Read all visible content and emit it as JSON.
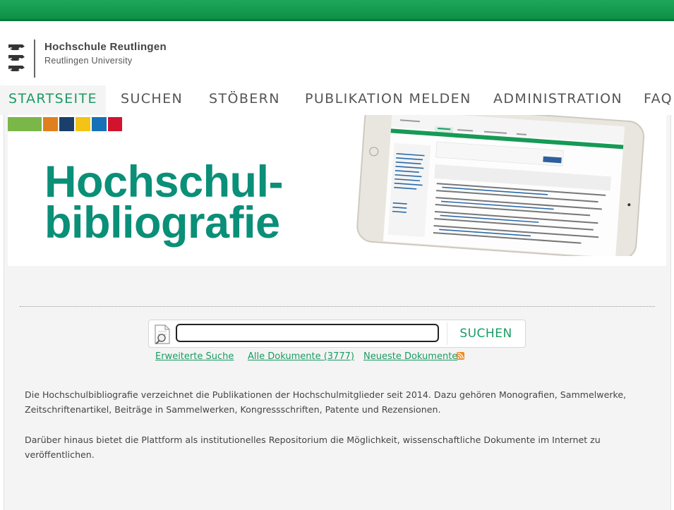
{
  "header": {
    "name": "Hochschule Reutlingen",
    "subname": "Reutlingen University"
  },
  "nav": {
    "items": [
      {
        "label": "STARTSEITE"
      },
      {
        "label": "SUCHEN"
      },
      {
        "label": "STÖBERN"
      },
      {
        "label": "PUBLIKATION MELDEN"
      },
      {
        "label": "ADMINISTRATION"
      },
      {
        "label": "FAQ"
      }
    ]
  },
  "banner": {
    "title_line1": "Hochschul-",
    "title_line2": "bibliografie",
    "color_blocks": [
      "#7ab648",
      "#e07f1d",
      "#1b3f6a",
      "#f3c316",
      "#1572b9",
      "#d1132e"
    ],
    "title_color": "#0a8f78"
  },
  "search": {
    "value": "",
    "button_label": "SUCHEN"
  },
  "links": {
    "advanced": "Erweiterte Suche",
    "all_docs": "Alle Dokumente (3777)",
    "newest": "Neueste Dokumente"
  },
  "content": {
    "paragraph1": "Die Hochschulbibliografie verzeichnet die Publikationen der Hochschulmitglieder seit 2014. Dazu gehören Monografien, Sammelwerke, Zeitschriftenartikel, Beiträge in Sammelwerken, Kongressschriften, Patente und Rezensionen.",
    "paragraph2": "Darüber hinaus bietet die Plattform als institutionelles Repositorium die Möglichkeit, wissenschaftliche Dokumente im Internet zu veröffentlichen."
  },
  "colors": {
    "accent": "#1a9b64",
    "topbar": "#129a4f"
  }
}
